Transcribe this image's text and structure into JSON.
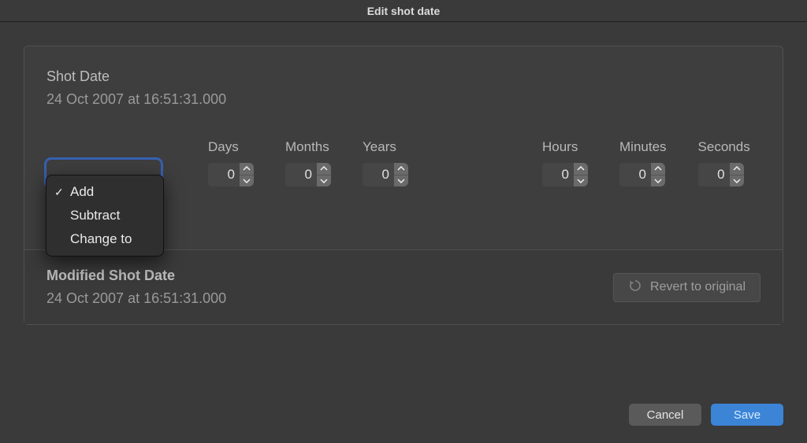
{
  "title": "Edit shot date",
  "shot_date": {
    "label": "Shot Date",
    "value": "24 Oct 2007 at 16:51:31.000"
  },
  "operation_menu": {
    "selected": "Add",
    "options": [
      "Add",
      "Subtract",
      "Change to"
    ]
  },
  "offset": {
    "days": {
      "label": "Days",
      "value": "0"
    },
    "months": {
      "label": "Months",
      "value": "0"
    },
    "years": {
      "label": "Years",
      "value": "0"
    },
    "hours": {
      "label": "Hours",
      "value": "0"
    },
    "minutes": {
      "label": "Minutes",
      "value": "0"
    },
    "seconds": {
      "label": "Seconds",
      "value": "0"
    }
  },
  "modified": {
    "label": "Modified Shot Date",
    "value": "24 Oct 2007 at 16:51:31.000"
  },
  "buttons": {
    "revert": "Revert to original",
    "cancel": "Cancel",
    "save": "Save"
  }
}
